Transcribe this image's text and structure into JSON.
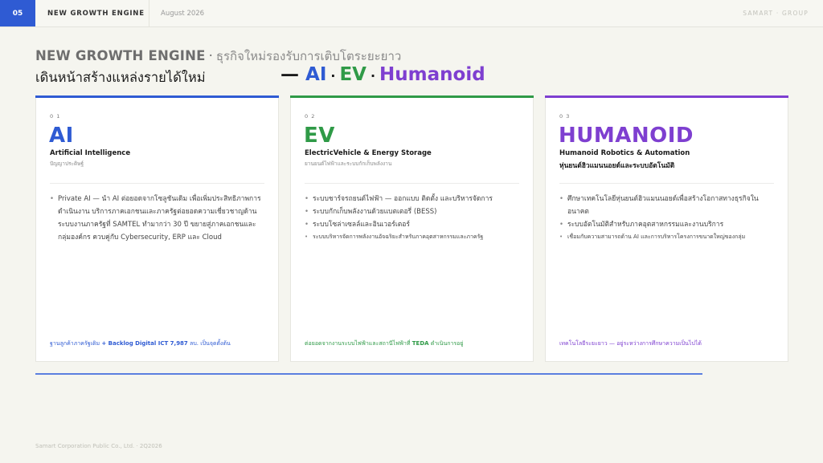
{
  "topbar": {
    "slide_number": "05",
    "section": "NEW GROWTH ENGINE",
    "date": "August 2026",
    "brand": "SAMART · GROUP"
  },
  "headline": {
    "title_bold": "NEW GROWTH ENGINE",
    "title_sep": "·",
    "title_thai": "ธุรกิจใหม่รองรับการเติบโตระยะยาว",
    "line2": "เดินหน้าสร้างแหล่งรายได้ใหม่",
    "tag_dash": "—",
    "tag_ai": "AI",
    "tag_sep1": "·",
    "tag_ev": "EV",
    "tag_sep2": "·",
    "tag_humanoid": "Humanoid"
  },
  "cards": [
    {
      "num": "0 1",
      "title": "AI",
      "subtitle": "Artificial Intelligence",
      "subtitle_thai": "ปัญญาประดิษฐ์",
      "bullets": [
        "Private AI — นำ AI ต่อยอดจากโซลูชันเดิม เพื่อเพิ่มประสิทธิภาพการดำเนินงาน บริการภาคเอกชนและภาครัฐต่อยอดความเชี่ยวชาญด้านระบบงานภาครัฐที่ SAMTEL ทำมากว่า 30 ปี ขยายสู่ภาคเอกชนและกลุ่มองค์กร ควบคู่กับ Cybersecurity, ERP และ Cloud"
      ],
      "footer_pre": "ฐานลูกค้าภาครัฐเดิม",
      "footer_hl": "+ Backlog Digital ICT 7,987",
      "footer_post": "ลบ. เป็นจุดตั้งต้น"
    },
    {
      "num": "0 2",
      "title": "EV",
      "subtitle": "ElectricVehicle & Energy Storage",
      "subtitle_thai": "ยานยนต์ไฟฟ้าและระบบกักเก็บพลังงาน",
      "bullets": [
        "ระบบชาร์จรถยนต์ไฟฟ้า — ออกแบบ ติดตั้ง และบริหารจัดการ",
        "ระบบกักเก็บพลังงานด้วยแบตเตอรี่ (BESS)",
        "ระบบโซล่าเซลล์และอินเวอร์เตอร์",
        "ระบบบริหารจัดการพลังงานอัจฉริยะสำหรับภาคอุตสาหกรรมและภาครัฐ"
      ],
      "footer_pre": "ต่อยอดจากงานระบบไฟฟ้าและสถานีไฟฟ้าที่",
      "footer_hl": "TEDA",
      "footer_post": "ดำเนินการอยู่"
    },
    {
      "num": "0 3",
      "title": "HUMANOID",
      "subtitle": "Humanoid Robotics & Automation",
      "subtitle_thai": "หุ่นยนต์ฮิวแมนนอยด์และระบบอัตโนมัติ",
      "bullets": [
        "ศึกษาเทคโนโลยีหุ่นยนต์ฮิวแมนนอยด์เพื่อสร้างโอกาสทางธุรกิจในอนาคต",
        "ระบบอัตโนมัติสำหรับภาคอุตสาหกรรมและงานบริการ",
        "เชื่อมกับความสามารถด้าน AI และการบริหารโครงการขนาดใหญ่ของกลุ่ม"
      ],
      "footer_pre": "เทคโนโลยีระยะยาว —",
      "footer_hl": "",
      "footer_post": "อยู่ระหว่างการศึกษาความเป็นไปได้"
    }
  ],
  "copyright": "Samart Corporation Public Co., Ltd. · 2Q2026",
  "colors": {
    "accent_blue": "#2f5bd3",
    "accent_green": "#2f9a47",
    "accent_purple": "#7e3fd0"
  }
}
